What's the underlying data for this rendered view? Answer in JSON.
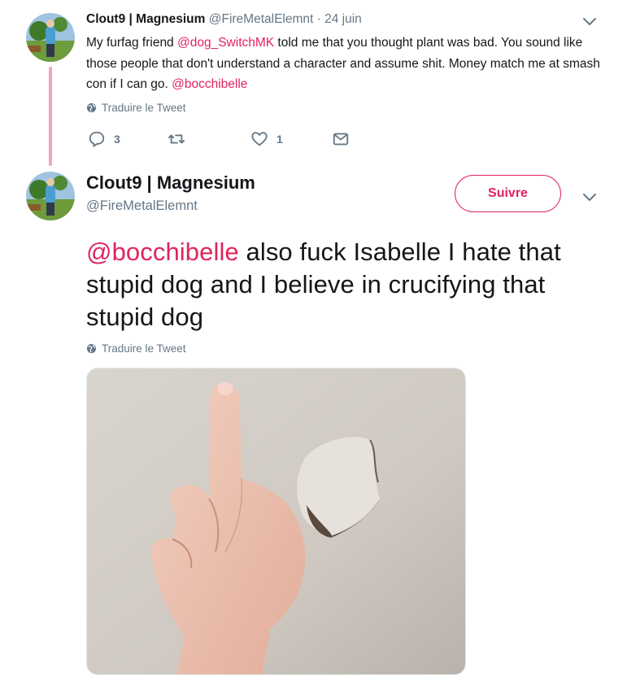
{
  "tweet1": {
    "display_name": "Clout9 | Magnesium",
    "handle": "@FireMetalElemnt",
    "separator": "·",
    "date": "24 juin",
    "text_parts": [
      {
        "text": "My furfag friend ",
        "kind": "plain"
      },
      {
        "text": "@dog_SwitchMK",
        "kind": "mention"
      },
      {
        "text": " told me that you thought plant was bad. You sound like those people that don't understand a character and assume shit. Money match me at smash con if I can go. ",
        "kind": "plain"
      },
      {
        "text": "@bocchibelle",
        "kind": "mention"
      }
    ],
    "translate_label": "Traduire le Tweet",
    "reply_count": "3",
    "retweet_count": "",
    "like_count": "1"
  },
  "tweet2": {
    "display_name": "Clout9 | Magnesium",
    "handle": "@FireMetalElemnt",
    "follow_label": "Suivre",
    "text_parts": [
      {
        "text": "@bocchibelle",
        "kind": "mention"
      },
      {
        "text": " also fuck Isabelle I hate that stupid dog and I believe in crucifying that stupid dog",
        "kind": "plain"
      }
    ],
    "translate_label": "Traduire le Tweet"
  },
  "icons": {
    "reply": "reply-icon",
    "retweet": "retweet-icon",
    "like": "heart-icon",
    "dm": "envelope-icon",
    "globe": "globe-icon",
    "caret": "chevron-down-icon"
  },
  "colors": {
    "accent": "#e0245e",
    "muted": "#657786",
    "text": "#14171a",
    "thread_line": "#f4a5b8"
  }
}
